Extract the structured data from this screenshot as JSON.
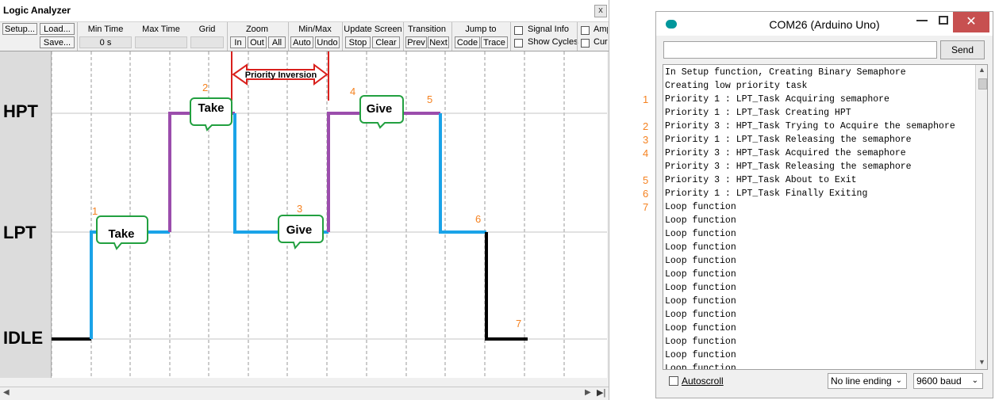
{
  "logic_analyzer": {
    "title": "Logic Analyzer",
    "close_glyph": "x",
    "toolbar": {
      "setup": "Setup...",
      "load": "Load...",
      "save": "Save...",
      "min_time_label": "Min Time",
      "min_time_value": "0 s",
      "max_time_label": "Max Time",
      "grid_label": "Grid",
      "zoom_label": "Zoom",
      "zoom_in": "In",
      "zoom_out": "Out",
      "zoom_all": "All",
      "minmax_label": "Min/Max",
      "minmax_auto": "Auto",
      "minmax_undo": "Undo",
      "update_label": "Update Screen",
      "update_stop": "Stop",
      "update_clear": "Clear",
      "transition_label": "Transition",
      "transition_prev": "Prev",
      "transition_next": "Next",
      "jump_label": "Jump to",
      "jump_code": "Code",
      "jump_trace": "Trace",
      "signal_info": "Signal Info",
      "show_cycles": "Show Cycles",
      "amp_partial": "Amp",
      "cur_partial": "Cur"
    },
    "signals": [
      "HPT",
      "LPT",
      "IDLE"
    ],
    "annotations": {
      "priority_inversion": "Priority Inversion",
      "bubbles": [
        "Take",
        "Take",
        "Give",
        "Give"
      ],
      "markers": [
        "1",
        "2",
        "3",
        "4",
        "5",
        "6",
        "7"
      ]
    },
    "colors": {
      "idle_trace": "#000000",
      "lpt_trace": "#1aa3e8",
      "hpt_trace": "#9b4dac",
      "bubble_border": "#22a040",
      "arrow": "#d9201c",
      "marker": "#f58220"
    }
  },
  "serial_monitor": {
    "title": "COM26 (Arduino Uno)",
    "send_label": "Send",
    "autoscroll_label": "Autoscroll",
    "line_ending": "No line ending",
    "baud": "9600 baud",
    "lines": [
      "In Setup function, Creating Binary Semaphore",
      "Creating low priority task",
      "Priority 1 : LPT_Task Acquiring semaphore",
      "Priority 1 : LPT_Task Creating HPT",
      "Priority 3 : HPT_Task Trying to Acquire the semaphore",
      "Priority 1 : LPT_Task Releasing the semaphore",
      "Priority 3 : HPT_Task Acquired the semaphore",
      "Priority 3 : HPT_Task Releasing the semaphore",
      "Priority 3 : HPT_Task About to Exit",
      "Priority 1 : LPT_Task Finally Exiting",
      "Loop function",
      "Loop function",
      "Loop function",
      "Loop function",
      "Loop function",
      "Loop function",
      "Loop function",
      "Loop function",
      "Loop function",
      "Loop function",
      "Loop function",
      "Loop function",
      "Loop function"
    ],
    "line_markers": [
      "1",
      "2",
      "3",
      "4",
      "5",
      "6",
      "7"
    ]
  }
}
